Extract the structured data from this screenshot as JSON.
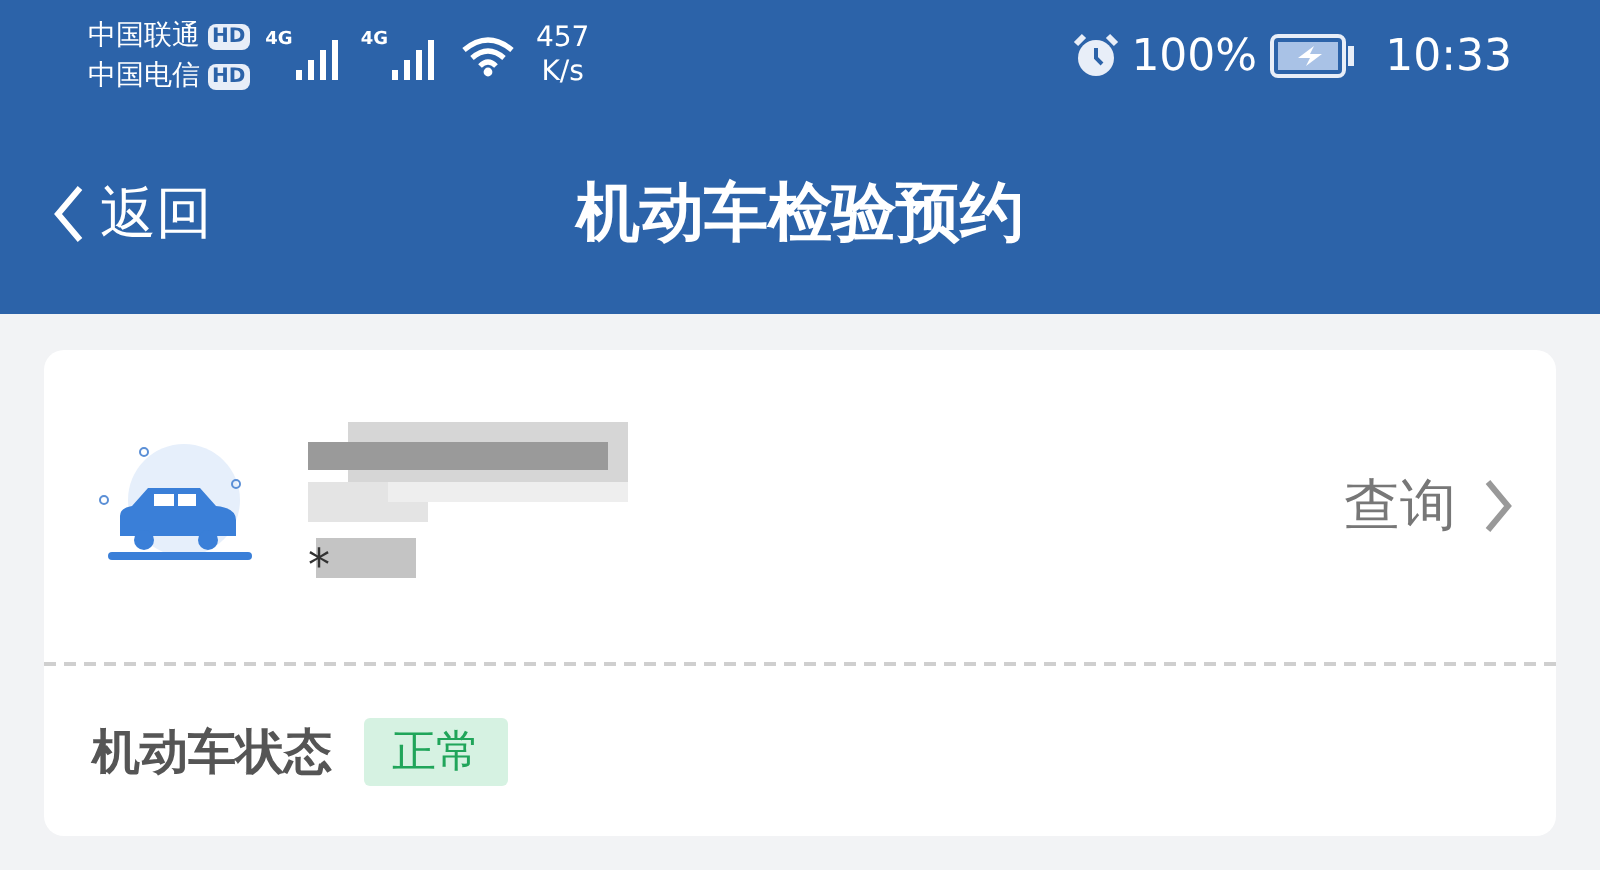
{
  "status_bar": {
    "carriers": [
      {
        "name": "中国联通",
        "badge": "HD",
        "network": "4G"
      },
      {
        "name": "中国电信",
        "badge": "HD",
        "network": "4G"
      }
    ],
    "speed_value": "457",
    "speed_unit": "K/s",
    "battery": "100%",
    "time": "10:33"
  },
  "header": {
    "back": "返回",
    "title": "机动车检验预约"
  },
  "vehicle": {
    "plate_prefix": "*",
    "action": "查询"
  },
  "status_row": {
    "label": "机动车状态",
    "tag": "正常"
  }
}
